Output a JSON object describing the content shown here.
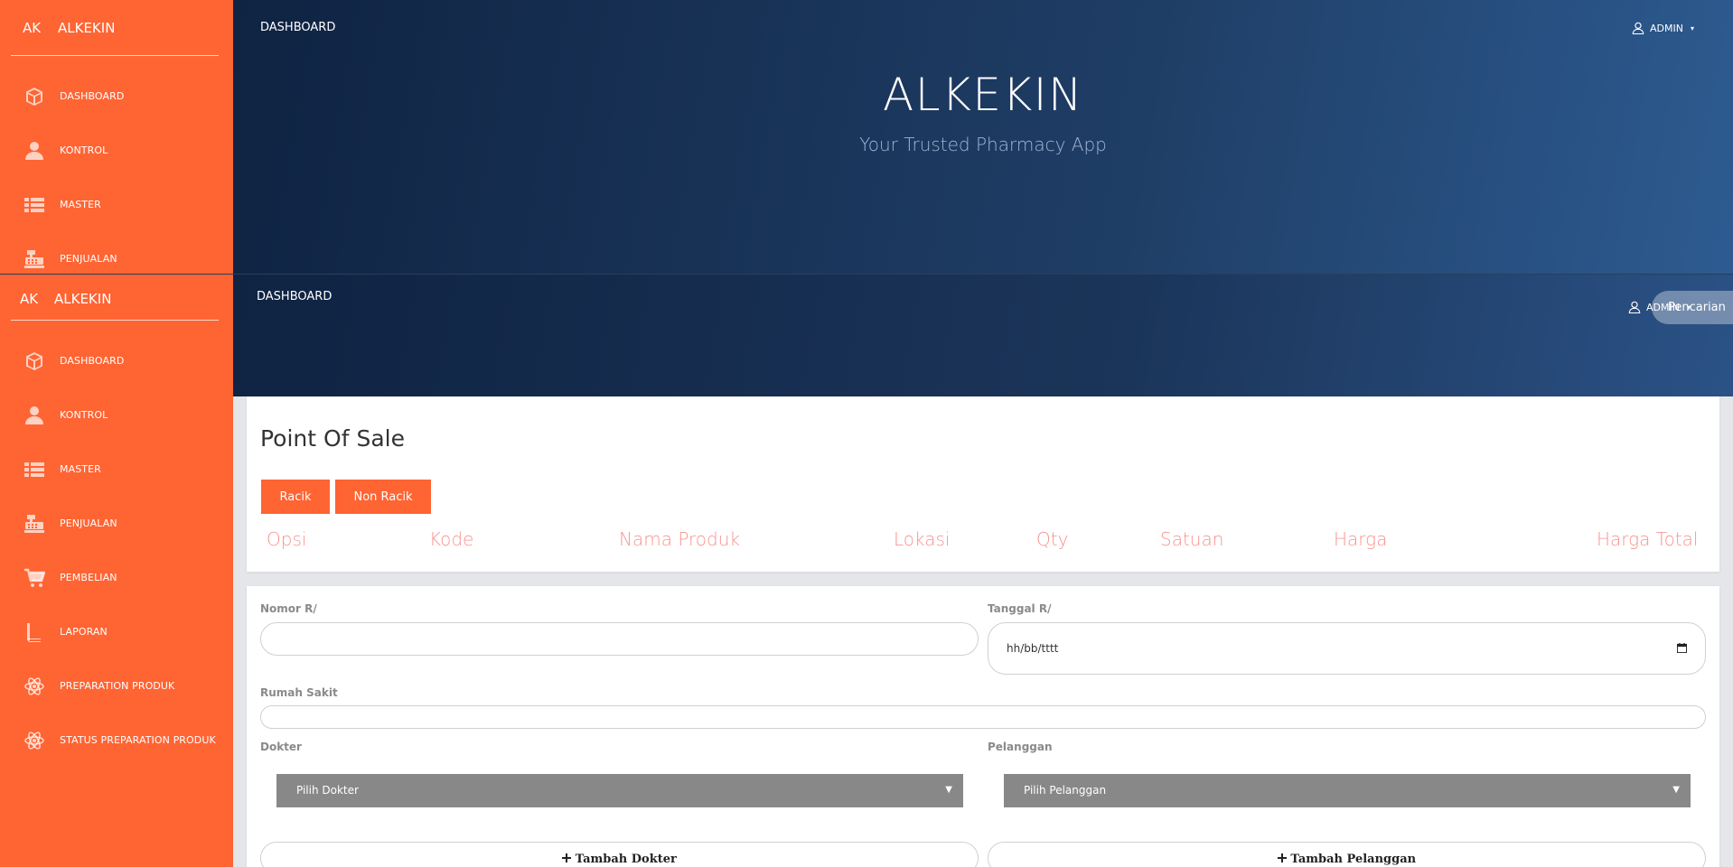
{
  "brand": {
    "short": "AK",
    "name": "ALKEKIN"
  },
  "sidebar": {
    "items": [
      {
        "label": "DASHBOARD",
        "icon": "cube-icon"
      },
      {
        "label": "KONTROL",
        "icon": "user-icon"
      },
      {
        "label": "MASTER",
        "icon": "list-icon"
      },
      {
        "label": "PENJUALAN",
        "icon": "cash-register-icon"
      },
      {
        "label": "PEMBELIAN",
        "icon": "cart-icon"
      },
      {
        "label": "LAPORAN",
        "icon": "book-icon"
      },
      {
        "label": "PREPARATION PRODUK",
        "icon": "atom-icon"
      },
      {
        "label": "STATUS PREPARATION PRODUK",
        "icon": "atom-icon"
      }
    ]
  },
  "header": {
    "dashboard_label": "DASHBOARD",
    "user_label": "ADMIN",
    "search_placeholder": "Pencarian"
  },
  "hero": {
    "title": "ALKEKIN",
    "subtitle": "Your Trusted Pharmacy App"
  },
  "pos": {
    "title": "Point Of Sale",
    "buttons": [
      "Racik",
      "Non Racik"
    ],
    "columns": [
      "Opsi",
      "Kode",
      "Nama Produk",
      "Lokasi",
      "Qty",
      "Satuan",
      "Harga",
      "Harga Total"
    ]
  },
  "form": {
    "nomor_label": "Nomor R/",
    "nomor_value": "",
    "tanggal_label": "Tanggal R/",
    "tanggal_placeholder": "hh/bb/tttt",
    "rumah_sakit_label": "Rumah Sakit",
    "rumah_sakit_value": "",
    "dokter_label": "Dokter",
    "dokter_select": "Pilih Dokter",
    "pelanggan_label": "Pelanggan",
    "pelanggan_select": "Pilih Pelanggan",
    "tambah_dokter": "Tambah Dokter",
    "tambah_pelanggan": "Tambah Pelanggan"
  },
  "colors": {
    "accent": "#ff6433",
    "header_dark": "#0f2342",
    "header_light": "#2d5b91",
    "column_header": "#f9938f"
  }
}
